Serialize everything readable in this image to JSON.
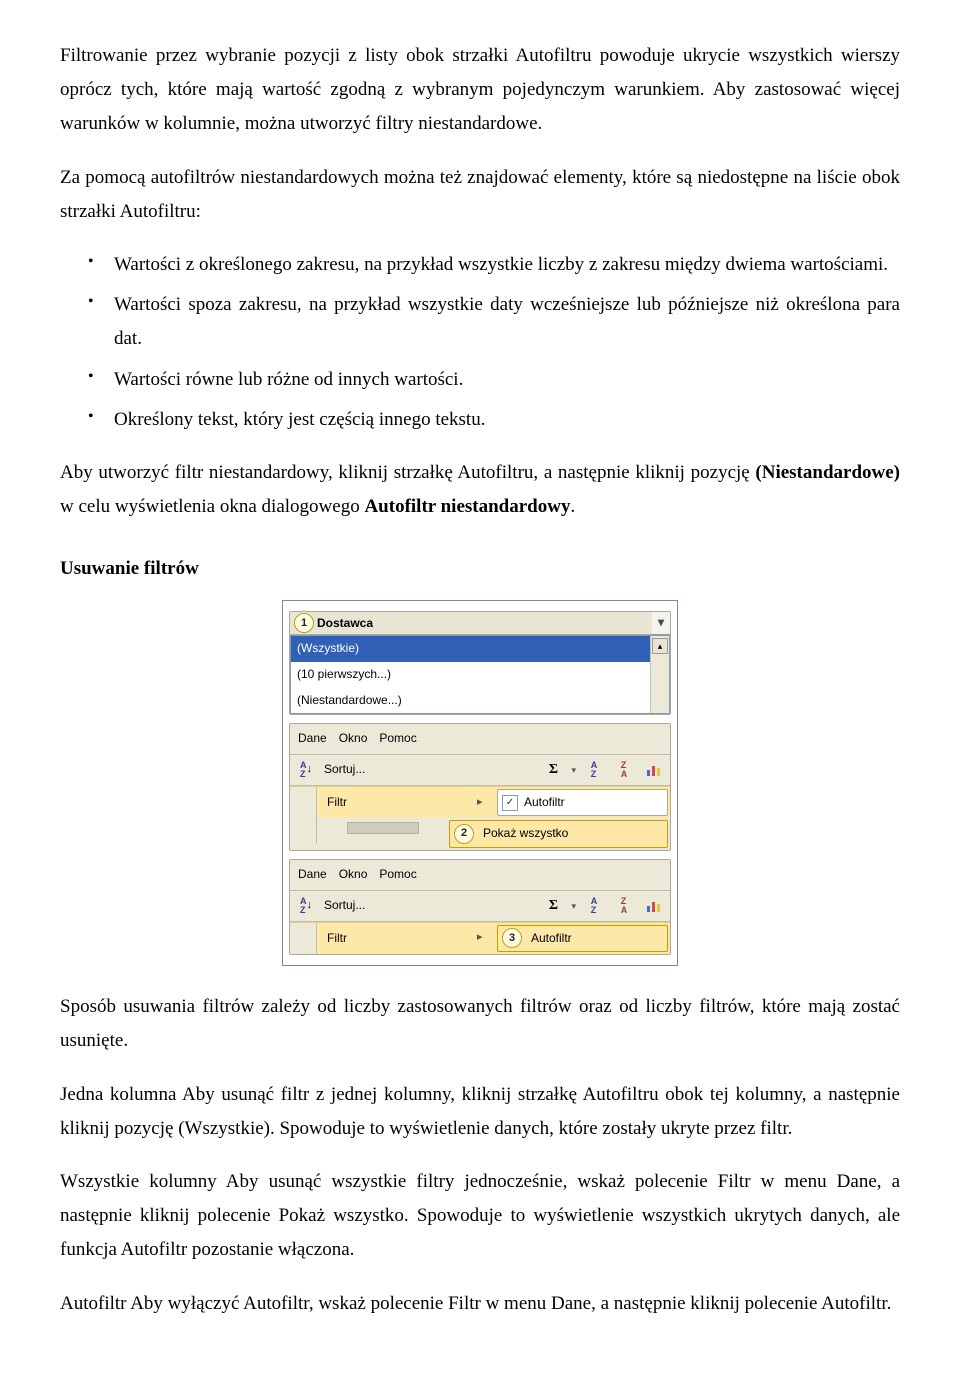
{
  "para1": "Filtrowanie przez wybranie pozycji z listy obok strzałki Autofiltru powoduje ukrycie wszystkich wierszy oprócz tych, które mają wartość zgodną z wybranym pojedynczym warunkiem. Aby zastosować więcej warunków w kolumnie, można utworzyć filtry niestandardowe.",
  "para2": "Za pomocą autofiltrów niestandardowych można też znajdować elementy, które są niedostępne na liście obok strzałki Autofiltru:",
  "bullets": [
    "Wartości z określonego zakresu, na przykład wszystkie liczby z zakresu między dwiema wartościami.",
    "Wartości spoza zakresu, na przykład wszystkie daty wcześniejsze lub późniejsze niż określona para dat.",
    "Wartości równe lub różne od innych wartości.",
    "Określony tekst, który jest częścią innego tekstu."
  ],
  "para3_pre": "Aby utworzyć filtr niestandardowy, kliknij strzałkę Autofiltru, a następnie kliknij pozycję ",
  "para3_bold1": "(Niestandardowe)",
  "para3_mid": " w celu wyświetlenia okna dialogowego ",
  "para3_bold2": "Autofiltr niestandardowy",
  "para3_end": ".",
  "heading_remove": "Usuwanie filtrów",
  "fig": {
    "dostawca": "Dostawca",
    "opt_all": "(Wszystkie)",
    "opt_top10": "(10 pierwszych...)",
    "opt_custom": "(Niestandardowe...)",
    "menu_dane": "Dane",
    "menu_okno": "Okno",
    "menu_pomoc": "Pomoc",
    "sortuj": "Sortuj...",
    "filtr": "Filtr",
    "autofiltr": "Autofiltr",
    "pokaz": "Pokaż wszystko",
    "c1": "1",
    "c2": "2",
    "c3": "3"
  },
  "para4": "Sposób usuwania filtrów zależy od liczby zastosowanych filtrów oraz od liczby filtrów, które mają zostać usunięte.",
  "p5_lead": "Jedna kolumna",
  "p5_rest": "   Aby usunąć filtr z jednej kolumny, kliknij strzałkę Autofiltru obok tej kolumny, a następnie kliknij pozycję (Wszystkie). Spowoduje to wyświetlenie danych, które zostały ukryte przez filtr.",
  "p6_lead": "Wszystkie kolumny",
  "p6_rest": "   Aby usunąć wszystkie filtry jednocześnie, wskaż polecenie Filtr w menu Dane, a następnie kliknij polecenie Pokaż wszystko. Spowoduje to wyświetlenie wszystkich ukrytych danych, ale funkcja Autofiltr pozostanie włączona.",
  "p7_lead": "Autofiltr",
  "p7_rest": "   Aby wyłączyć Autofiltr, wskaż polecenie Filtr w menu Dane, a następnie kliknij polecenie Autofiltr."
}
